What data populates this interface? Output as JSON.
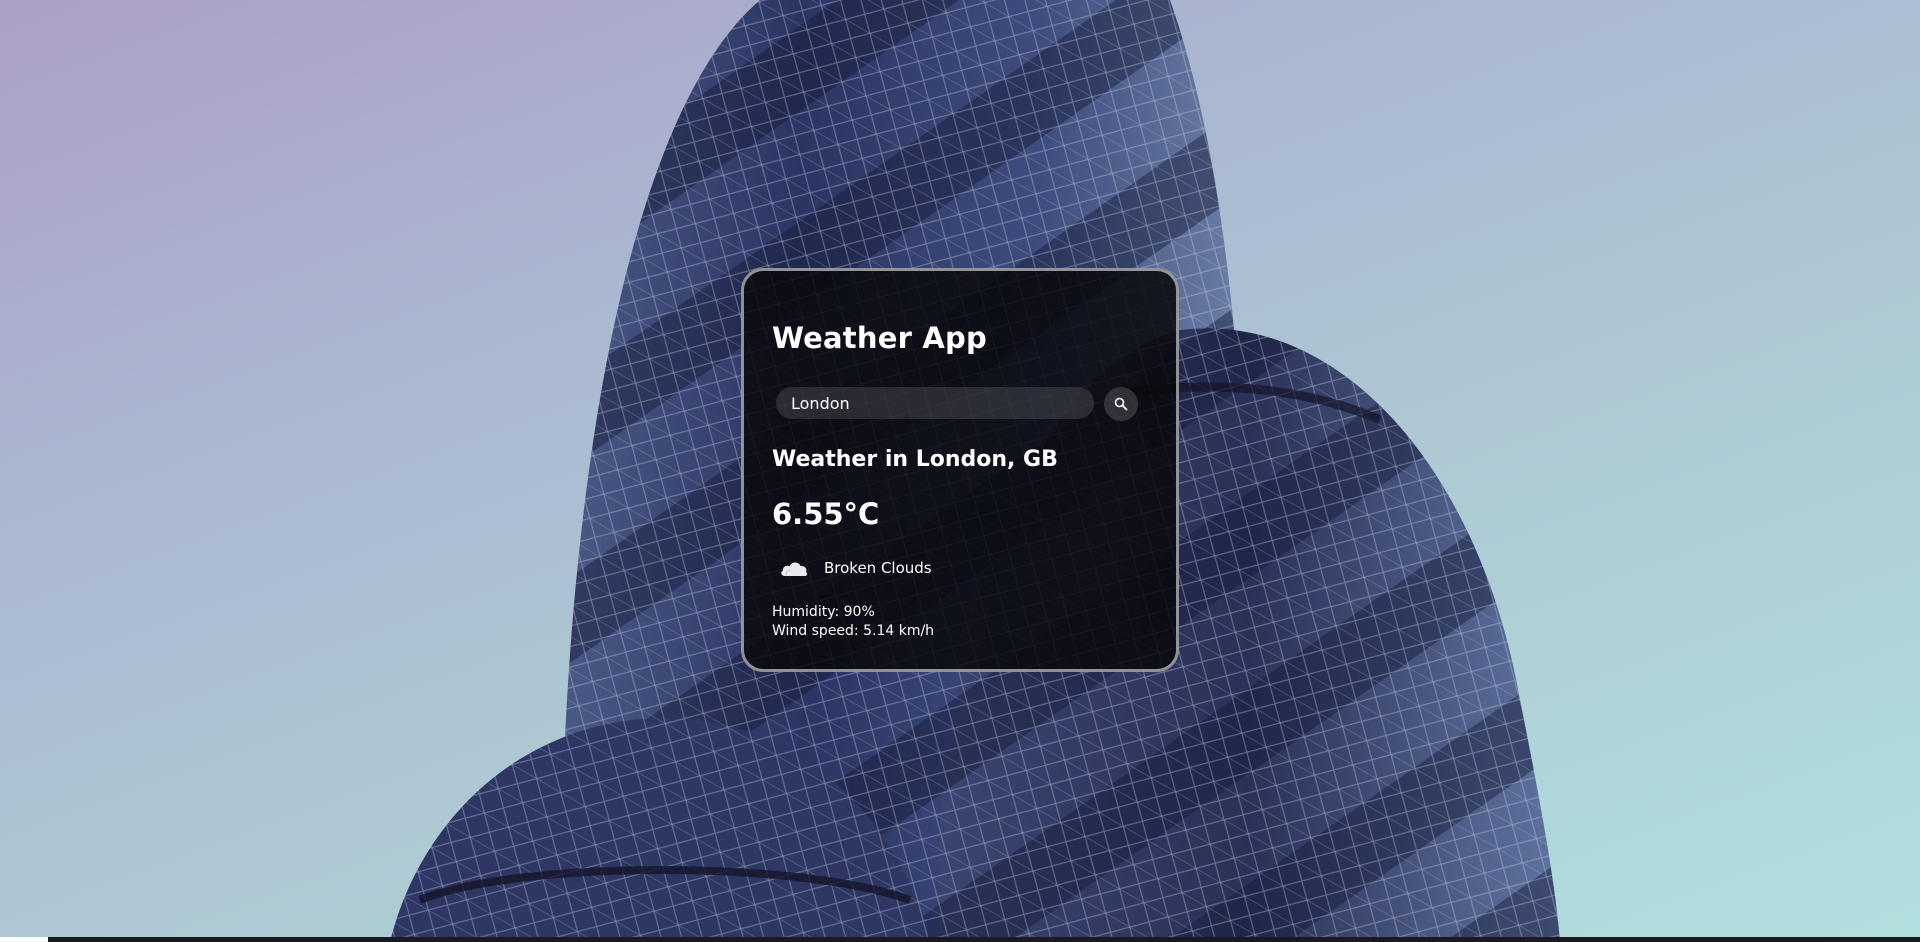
{
  "app": {
    "title": "Weather App"
  },
  "search": {
    "value": "London",
    "button_icon": "search-icon"
  },
  "weather": {
    "location": "Weather in London, GB",
    "temperature": "6.55°C",
    "condition_icon": "cloud-icon",
    "condition": "Broken Clouds",
    "humidity": "Humidity: 90%",
    "wind": "Wind speed: 5.14 km/h"
  },
  "colors": {
    "card_background": "#08080c",
    "text": "#ffffff",
    "sky_top": "#ad9fc7",
    "sky_bottom": "#b0e0df",
    "building_glass": "#2a3560"
  }
}
